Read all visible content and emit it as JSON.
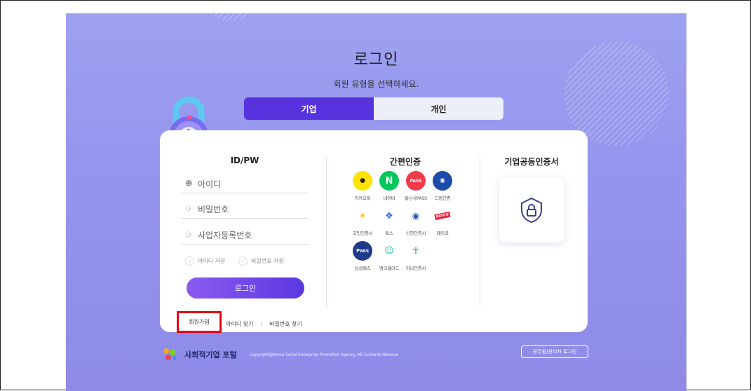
{
  "header": {
    "title": "로그인",
    "subtitle": "회원 유형을 선택하세요."
  },
  "tabs": [
    {
      "label": "기업",
      "active": true
    },
    {
      "label": "개인",
      "active": false
    }
  ],
  "idpw": {
    "title": "ID/PW",
    "id_placeholder": "아이디",
    "password_placeholder": "비밀번호",
    "bizno_placeholder": "사업자등록번호",
    "save_id_label": "아이디 저장",
    "save_pw_label": "비밀번호 저장",
    "login_label": "로그인",
    "signup_label": "회원가입",
    "find_id_label": "아이디 찾기",
    "find_pw_label": "비밀번호 찾기"
  },
  "simple_auth": {
    "title": "간편인증",
    "items": [
      {
        "label": "카카오톡",
        "icon": "kakao-icon",
        "color": "#fee500"
      },
      {
        "label": "네이버",
        "icon": "naver-icon",
        "color": "#03c75a"
      },
      {
        "label": "통신사PASS",
        "icon": "pass-icon",
        "color": "#f23a4b",
        "text": "PASS"
      },
      {
        "label": "드림인증",
        "icon": "dream-icon",
        "color": "#1d4ba8"
      },
      {
        "label": "국민인증서",
        "icon": "kb-icon",
        "color": "#ffffff"
      },
      {
        "label": "토스",
        "icon": "toss-icon",
        "color": "#ffffff"
      },
      {
        "label": "신한인증서",
        "icon": "shinhan-icon",
        "color": "#ffffff"
      },
      {
        "label": "페이코",
        "icon": "payco-icon",
        "color": "#ffffff",
        "text": "PAYCO"
      },
      {
        "label": "삼성패스",
        "icon": "samsung-pass-icon",
        "color": "#1f3a8a",
        "text": "Pass"
      },
      {
        "label": "뱅크샐러드",
        "icon": "banksalad-icon",
        "color": "#ffffff"
      },
      {
        "label": "하나인증서",
        "icon": "hana-icon",
        "color": "#ffffff"
      }
    ]
  },
  "corp_cert": {
    "title": "기업공동인증서"
  },
  "footer": {
    "logo_text": "사회적기업 포털",
    "copyright": "Copyright@Korea Social Enterprise Promotion Agency. All Contents Reserve",
    "admin_login_label": "공무원/관리자 로그인"
  }
}
